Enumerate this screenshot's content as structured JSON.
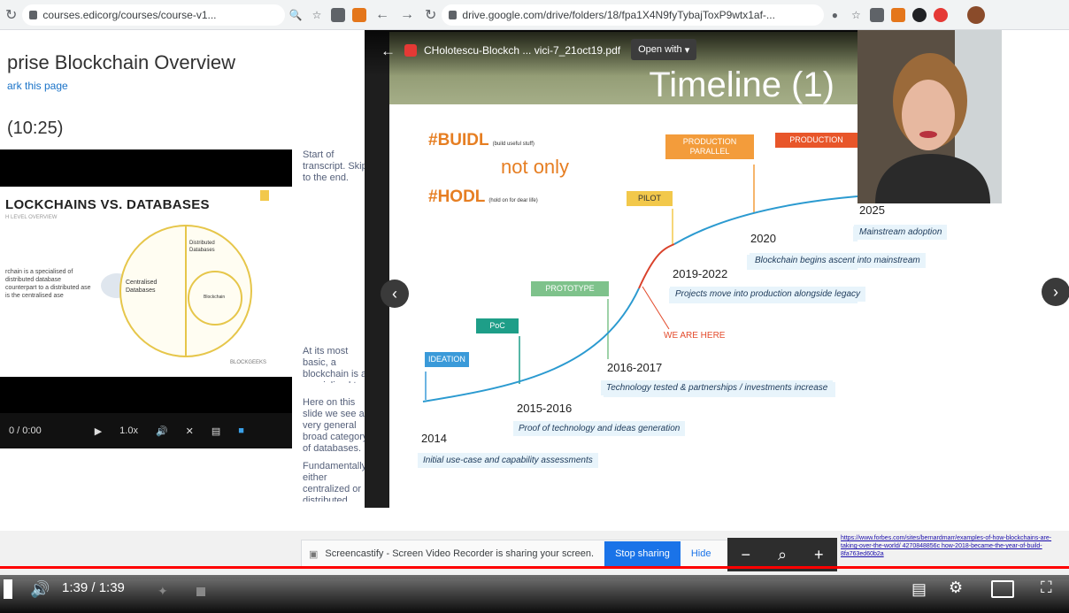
{
  "browser_left": {
    "url": "courses.edicorg/courses/course-v1...",
    "reload_icon": "reload-icon",
    "nav_back": "C"
  },
  "browser_right": {
    "url": "drive.google.com/drive/folders/18/fpa1X4N9fyTybajToxP9wtx1af-..."
  },
  "course": {
    "title": "prise Blockchain Overview",
    "bookmark_link": "ark this page",
    "video_title": "(10:25)",
    "slide": {
      "heading": "LOCKCHAINS VS. DATABASES",
      "subheading": "H LEVEL OVERVIEW",
      "left_text": "rchain is a specialised of distributed database counterpart to a distributed ase is the centralised ase",
      "center_label": "Centralised Databases",
      "right_label": "Distributed Databases",
      "inner_label": "Blockchain",
      "logo_text": "BLOCKGEEKS"
    },
    "controls": {
      "time": "0 / 0:00",
      "speed": "1.0x"
    },
    "transcript": [
      "Start of transcript. Skip to the end.",
      "At its most basic, a blockchain is a specialized t",
      "Here on this slide we see a very general broad category of databases.",
      "Fundamentally either centralized or distributed"
    ]
  },
  "pdf": {
    "file_name": "CHolotescu-Blockch ... vici-7_21oct19.pdf",
    "open_with": "Open with",
    "slide_title": "Timeline (1)",
    "hash1": "#BUIDL",
    "hash1_note": "(build useful stuff)",
    "not_only": "not only",
    "hash2": "#HODL",
    "hash2_note": "(hold on for dear life)",
    "phases": [
      {
        "label": "IDEATION",
        "color": "#3a9ad9"
      },
      {
        "label": "PoC",
        "color": "#1e9e88"
      },
      {
        "label": "PROTOTYPE",
        "color": "#7ec28b"
      },
      {
        "label": "PILOT",
        "color": "#f2c84b"
      },
      {
        "label": "PRODUCTION PARALLEL",
        "color": "#f39c3b"
      },
      {
        "label": "PRODUCTION",
        "color": "#e8562a"
      }
    ],
    "we_are_here": "WE ARE HERE",
    "milestones": [
      {
        "year": "2014",
        "desc": "Initial use-case and capability assessments"
      },
      {
        "year": "2015-2016",
        "desc": "Proof of technology and ideas generation"
      },
      {
        "year": "2016-2017",
        "desc": "Technology tested & partnerships / investments increase"
      },
      {
        "year": "2019-2022",
        "desc": "Projects move into production alongside legacy"
      },
      {
        "year": "2020",
        "desc": "Blockchain begins ascent into mainstream"
      },
      {
        "year": "2025",
        "desc": "Mainstream adoption"
      }
    ]
  },
  "screen_share": {
    "message": "Screencastify - Screen Video Recorder is sharing your screen.",
    "stop_label": "Stop sharing",
    "hide_label": "Hide"
  },
  "link_text": "https://www.forbes.com/sites/bernardmarr/examples-of-how-blockchains-are-taking-over-the-world/ 4270848856c how-2018-became-the-year-of-build-8fa763ed60b2a",
  "player": {
    "time_display": "1:39 / 1:39",
    "progress": 1.0,
    "progress_color": "#ff0000"
  }
}
